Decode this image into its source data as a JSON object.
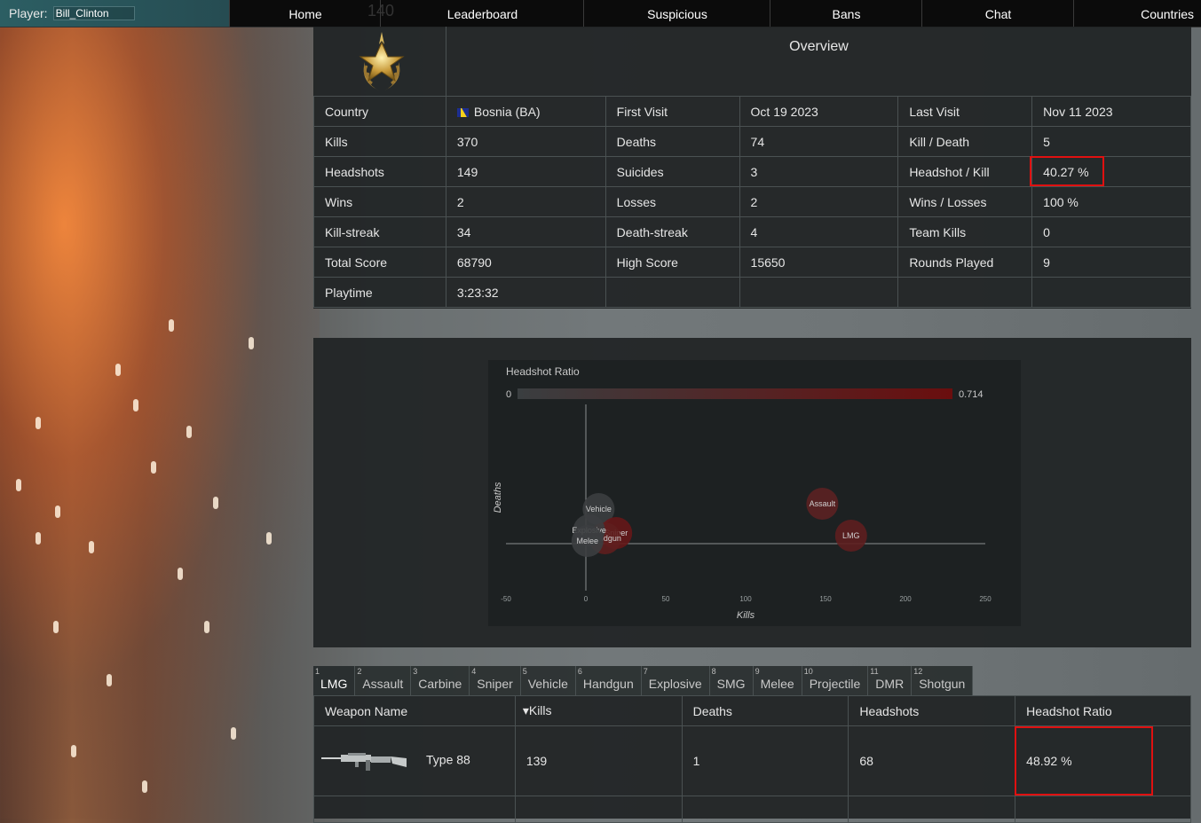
{
  "nav": {
    "player_label": "Player:",
    "player_name": "Bill_Clinton",
    "items": [
      "Home",
      "Leaderboard",
      "Suspicious",
      "Bans",
      "Chat",
      "Countries"
    ],
    "ghost_text": "140"
  },
  "overview": {
    "title": "Overview",
    "rows": [
      [
        "Country",
        "Bosnia (BA)",
        "First Visit",
        "Oct 19 2023",
        "Last Visit",
        "Nov 11 2023"
      ],
      [
        "Kills",
        "370",
        "Deaths",
        "74",
        "Kill / Death",
        "5"
      ],
      [
        "Headshots",
        "149",
        "Suicides",
        "3",
        "Headshot / Kill",
        "40.27 %"
      ],
      [
        "Wins",
        "2",
        "Losses",
        "2",
        "Wins / Losses",
        "100 %"
      ],
      [
        "Kill-streak",
        "34",
        "Death-streak",
        "4",
        "Team Kills",
        "0"
      ],
      [
        "Total Score",
        "68790",
        "High Score",
        "15650",
        "Rounds Played",
        "9"
      ],
      [
        "Playtime",
        "3:23:32",
        "",
        "",
        "",
        ""
      ]
    ]
  },
  "chart_data": {
    "type": "scatter",
    "colorbar_title": "Headshot Ratio",
    "colorbar_range": [
      0,
      0.714
    ],
    "colorbar_min_label": "0",
    "colorbar_max_label": "0.714",
    "xlabel": "Kills",
    "ylabel": "Deaths",
    "xlim": [
      -50,
      250
    ],
    "x_ticks": [
      -50,
      0,
      50,
      100,
      150,
      200,
      250
    ],
    "points": [
      {
        "label": "Assault",
        "x": 148,
        "y": 15,
        "ratio": 0.45
      },
      {
        "label": "LMG",
        "x": 166,
        "y": 3,
        "ratio": 0.49
      },
      {
        "label": "Vehicle",
        "x": 8,
        "y": 13,
        "ratio": 0.0
      },
      {
        "label": "Sniper",
        "x": 19,
        "y": 4,
        "ratio": 0.6
      },
      {
        "label": "Handgun",
        "x": 12,
        "y": 2,
        "ratio": 0.5
      },
      {
        "label": "Explosive",
        "x": 2,
        "y": 5,
        "ratio": 0.0
      },
      {
        "label": "Melee",
        "x": 1,
        "y": 1,
        "ratio": 0.0
      }
    ]
  },
  "tabs": [
    {
      "num": "1",
      "label": "LMG",
      "active": true
    },
    {
      "num": "2",
      "label": "Assault"
    },
    {
      "num": "3",
      "label": "Carbine"
    },
    {
      "num": "4",
      "label": "Sniper"
    },
    {
      "num": "5",
      "label": "Vehicle"
    },
    {
      "num": "6",
      "label": "Handgun"
    },
    {
      "num": "7",
      "label": "Explosive"
    },
    {
      "num": "8",
      "label": "SMG"
    },
    {
      "num": "9",
      "label": "Melee"
    },
    {
      "num": "10",
      "label": "Projectile"
    },
    {
      "num": "11",
      "label": "DMR"
    },
    {
      "num": "12",
      "label": "Shotgun"
    }
  ],
  "weapons": {
    "headers": [
      "Weapon Name",
      "Kills",
      "Deaths",
      "Headshots",
      "Headshot Ratio"
    ],
    "sort_indicator": "▾",
    "rows": [
      {
        "name": "Type 88",
        "kills": "139",
        "deaths": "1",
        "headshots": "68",
        "ratio": "48.92 %"
      }
    ]
  }
}
